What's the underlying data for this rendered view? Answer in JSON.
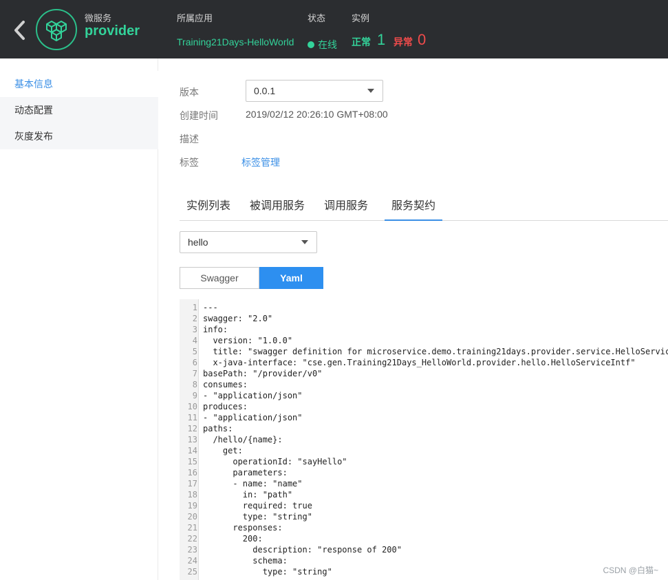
{
  "header": {
    "service_label": "微服务",
    "service_name": "provider",
    "app_label": "所属应用",
    "app_value": "Training21Days-HelloWorld",
    "status_label": "状态",
    "status_value": "在线",
    "instance_label": "实例",
    "normal_label": "正常",
    "normal_count": "1",
    "abnormal_label": "异常",
    "abnormal_count": "0",
    "accent": "#33d39a",
    "danger": "#f04b4b",
    "icons": {
      "back": "chevron-left-icon",
      "logo": "microservice-cubes-icon"
    }
  },
  "sidebar": {
    "items": [
      {
        "label": "基本信息"
      },
      {
        "label": "动态配置"
      },
      {
        "label": "灰度发布"
      }
    ]
  },
  "info": {
    "version_label": "版本",
    "version_value": "0.0.1",
    "created_label": "创建时间",
    "created_value": "2019/02/12 20:26:10 GMT+08:00",
    "desc_label": "描述",
    "tags_label": "标签",
    "tags_link": "标签管理"
  },
  "tabs": [
    {
      "label": "实例列表"
    },
    {
      "label": "被调用服务"
    },
    {
      "label": "调用服务"
    },
    {
      "label": "服务契约"
    }
  ],
  "contract": {
    "schema_select": "hello",
    "toggle_swagger": "Swagger",
    "toggle_yaml": "Yaml",
    "lines": [
      [
        "1",
        "---"
      ],
      [
        "2",
        "swagger: \"2.0\""
      ],
      [
        "3",
        "info:"
      ],
      [
        "4",
        "  version: \"1.0.0\""
      ],
      [
        "5",
        "  title: \"swagger definition for microservice.demo.training21days.provider.service.HelloService\""
      ],
      [
        "6",
        "  x-java-interface: \"cse.gen.Training21Days_HelloWorld.provider.hello.HelloServiceIntf\""
      ],
      [
        "7",
        "basePath: \"/provider/v0\""
      ],
      [
        "8",
        "consumes:"
      ],
      [
        "9",
        "- \"application/json\""
      ],
      [
        "10",
        "produces:"
      ],
      [
        "11",
        "- \"application/json\""
      ],
      [
        "12",
        "paths:"
      ],
      [
        "13",
        "  /hello/{name}:"
      ],
      [
        "14",
        "    get:"
      ],
      [
        "15",
        "      operationId: \"sayHello\""
      ],
      [
        "16",
        "      parameters:"
      ],
      [
        "17",
        "      - name: \"name\""
      ],
      [
        "18",
        "        in: \"path\""
      ],
      [
        "19",
        "        required: true"
      ],
      [
        "20",
        "        type: \"string\""
      ],
      [
        "21",
        "      responses:"
      ],
      [
        "22",
        "        200:"
      ],
      [
        "23",
        "          description: \"response of 200\""
      ],
      [
        "24",
        "          schema:"
      ],
      [
        "25",
        "            type: \"string\""
      ]
    ]
  },
  "watermark": "CSDN @白猫~"
}
